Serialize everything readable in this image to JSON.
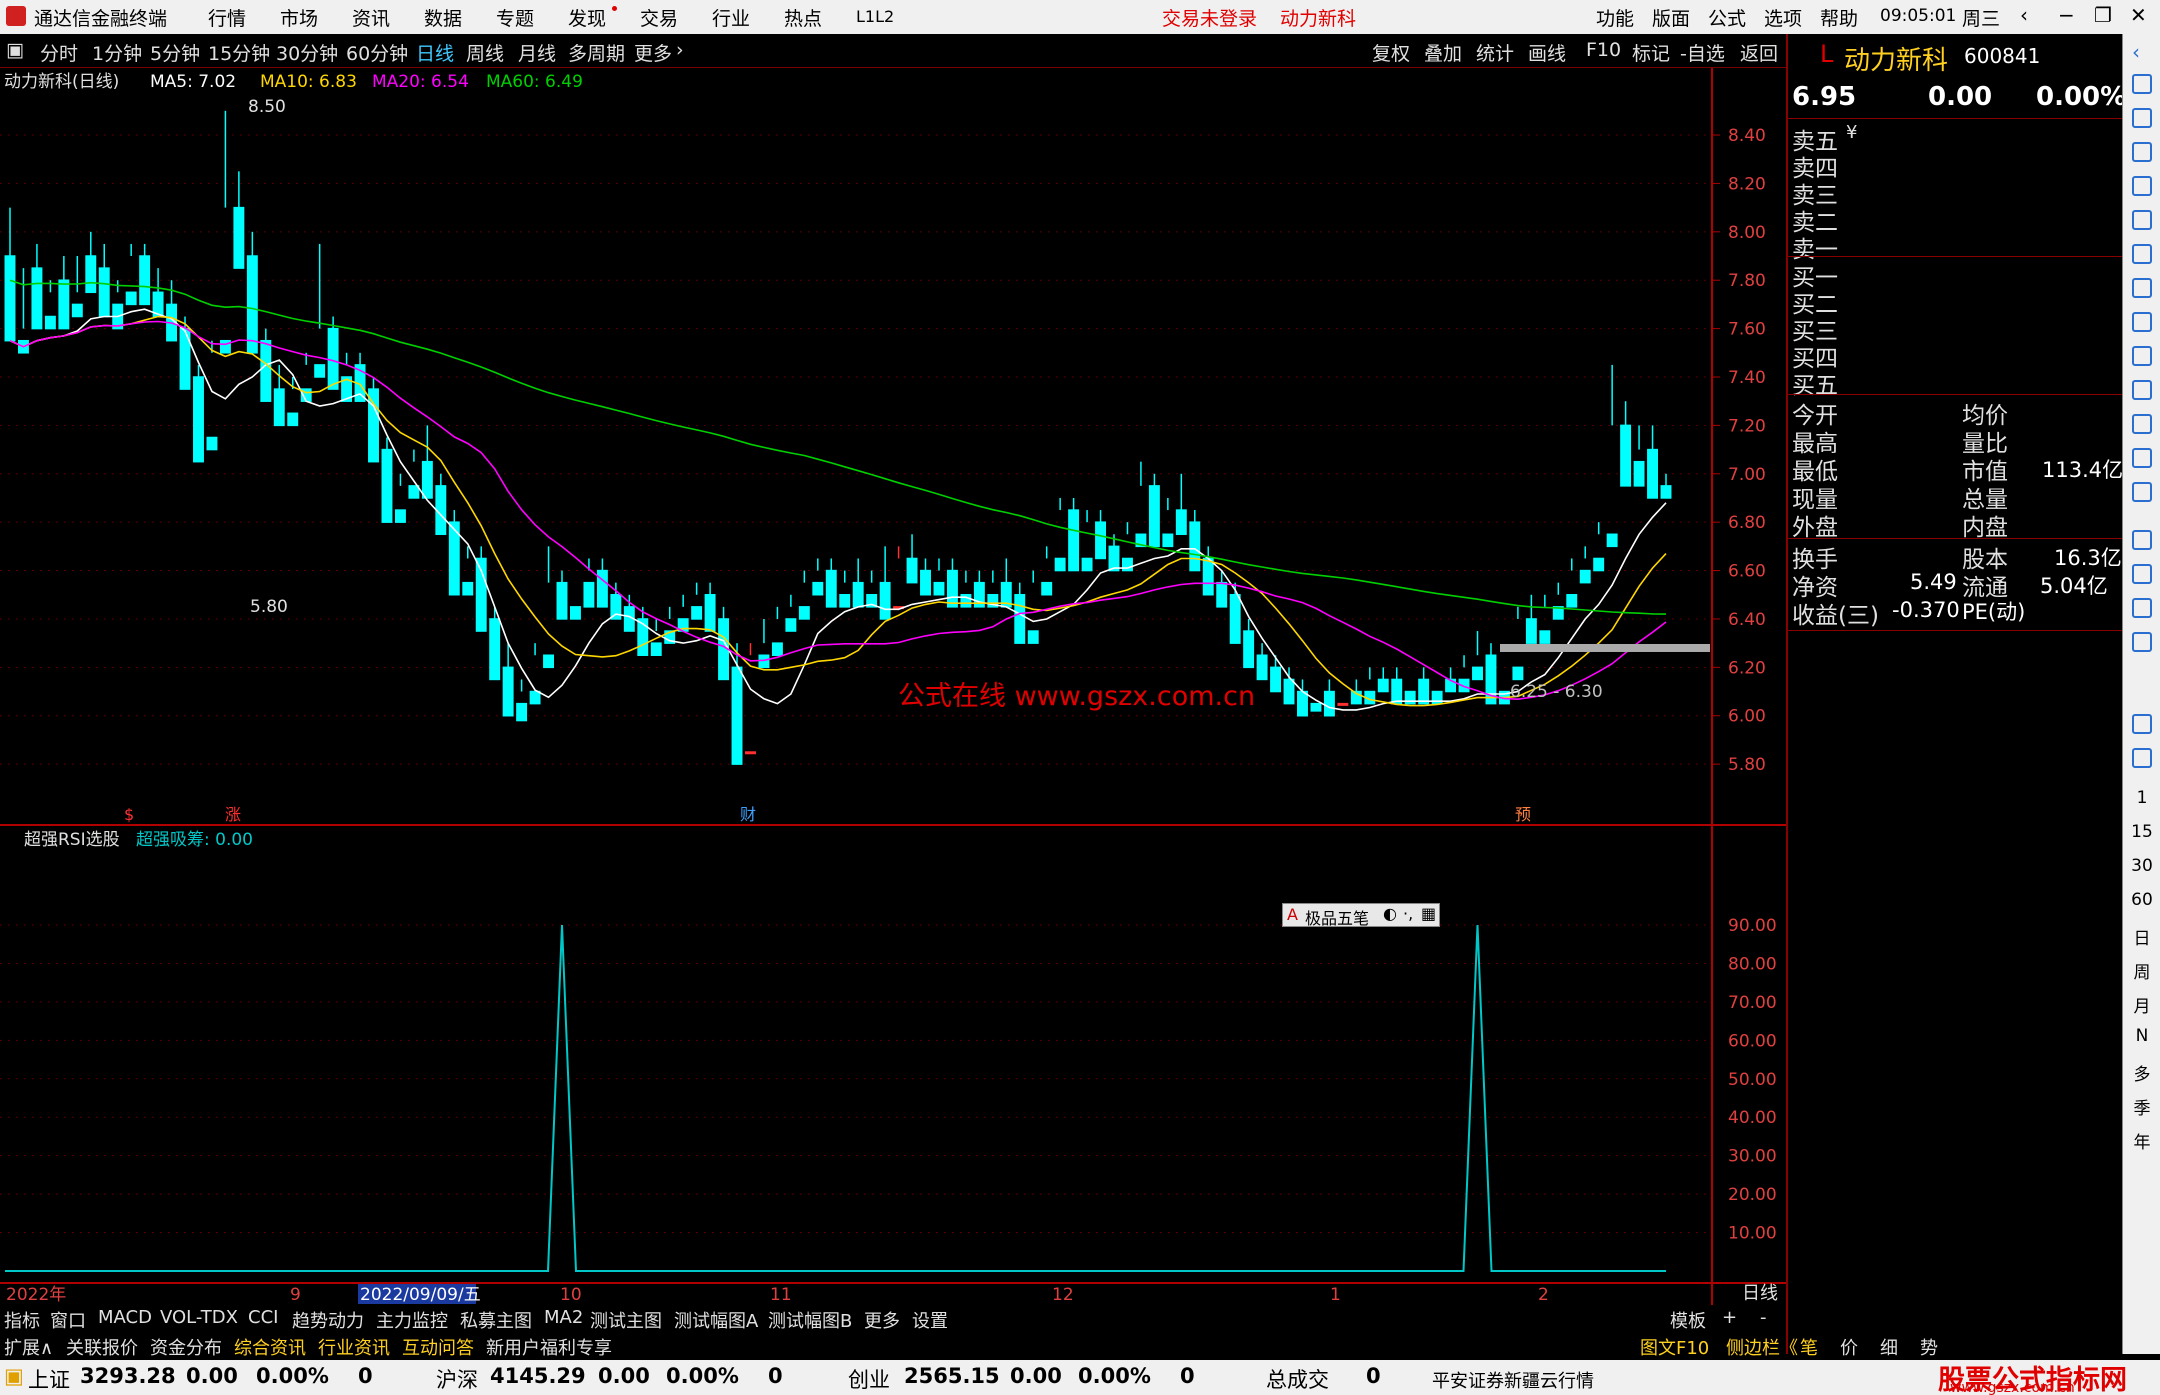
{
  "app": {
    "title": "通达信金融终端",
    "menus": [
      "行情",
      "市场",
      "资讯",
      "数据",
      "专题",
      "发现",
      "交易",
      "行业",
      "热点",
      "L1L2"
    ],
    "login": "交易未登录",
    "stock_link": "动力新科",
    "right_menus": [
      "功能",
      "版面",
      "公式",
      "选项",
      "帮助"
    ],
    "time": "09:05:01",
    "weekday": "周三"
  },
  "toolbar": {
    "periods": [
      "分时",
      "1分钟",
      "5分钟",
      "15分钟",
      "30分钟",
      "60分钟",
      "日线",
      "周线",
      "月线",
      "多周期",
      "更多"
    ],
    "selected": "日线",
    "tools": [
      "复权",
      "叠加",
      "统计",
      "画线",
      "F10",
      "标记",
      "-自选",
      "返回"
    ]
  },
  "main_chart": {
    "title": "动力新科(日线)",
    "ma5": "MA5: 7.02",
    "ma10": "MA10: 6.83",
    "ma20": "MA20: 6.54",
    "ma60": "MA60: 6.49",
    "high_label": "8.50",
    "low_label": "5.80",
    "range_label": "6.25 - 6.30",
    "watermark": "公式在线  www.gszx.com.cn",
    "markers": [
      "$",
      "涨",
      "财",
      "预"
    ]
  },
  "sub_chart": {
    "title": "超强RSI选股",
    "value_label": "超强吸筹: 0.00"
  },
  "popup": {
    "label": "极品五笔"
  },
  "colors": {
    "up": "#ff3030",
    "down": "#00ffff",
    "ma5": "#ffffff",
    "ma10": "#ffd700",
    "ma20": "#ff00ff",
    "ma60": "#00d000",
    "axis": "#b00000",
    "rsi": "#00c8c8"
  },
  "chart_data": [
    {
      "type": "candlestick",
      "title": "动力新科(日线)",
      "ylim": [
        5.7,
        8.5
      ],
      "yticks": [
        5.8,
        6.0,
        6.2,
        6.4,
        6.6,
        6.8,
        7.0,
        7.2,
        7.4,
        7.6,
        7.8,
        8.0,
        8.2,
        8.4
      ],
      "high_marker": 8.5,
      "low_marker": 5.8,
      "x_labels": [
        "2022年",
        "9",
        "2022/09/09/五",
        "10",
        "11",
        "12",
        "1",
        "2"
      ],
      "candles": [
        [
          7.9,
          8.1,
          7.6,
          7.55
        ],
        [
          7.55,
          7.6,
          7.85,
          7.5
        ],
        [
          7.85,
          7.95,
          7.65,
          7.6
        ],
        [
          7.65,
          7.75,
          7.8,
          7.6
        ],
        [
          7.8,
          7.9,
          7.7,
          7.6
        ],
        [
          7.7,
          7.75,
          7.9,
          7.65
        ],
        [
          7.9,
          8.0,
          7.85,
          7.75
        ],
        [
          7.85,
          7.95,
          7.7,
          7.65
        ],
        [
          7.7,
          7.8,
          7.75,
          7.6
        ],
        [
          7.75,
          7.95,
          7.9,
          7.7
        ],
        [
          7.9,
          7.95,
          7.75,
          7.7
        ],
        [
          7.75,
          7.85,
          7.7,
          7.65
        ],
        [
          7.7,
          7.8,
          7.6,
          7.55
        ],
        [
          7.6,
          7.65,
          7.4,
          7.35
        ],
        [
          7.4,
          7.45,
          7.15,
          7.05
        ],
        [
          7.15,
          7.5,
          7.55,
          7.1
        ],
        [
          7.55,
          8.5,
          8.1,
          7.5
        ],
        [
          8.1,
          8.25,
          7.9,
          7.85
        ],
        [
          7.9,
          8.0,
          7.55,
          7.5
        ],
        [
          7.55,
          7.6,
          7.35,
          7.3
        ],
        [
          7.35,
          7.45,
          7.25,
          7.2
        ],
        [
          7.25,
          7.4,
          7.35,
          7.2
        ],
        [
          7.35,
          7.5,
          7.45,
          7.3
        ],
        [
          7.45,
          7.95,
          7.6,
          7.4
        ],
        [
          7.6,
          7.65,
          7.4,
          7.35
        ],
        [
          7.4,
          7.5,
          7.45,
          7.3
        ],
        [
          7.45,
          7.5,
          7.35,
          7.3
        ],
        [
          7.35,
          7.4,
          7.1,
          7.05
        ],
        [
          7.1,
          7.15,
          6.85,
          6.8
        ],
        [
          6.85,
          7.0,
          6.95,
          6.8
        ],
        [
          6.95,
          7.1,
          7.05,
          6.9
        ],
        [
          7.05,
          7.2,
          6.95,
          6.9
        ],
        [
          6.95,
          7.0,
          6.8,
          6.75
        ],
        [
          6.8,
          6.85,
          6.55,
          6.5
        ],
        [
          6.55,
          6.7,
          6.65,
          6.5
        ],
        [
          6.65,
          6.7,
          6.4,
          6.35
        ],
        [
          6.4,
          6.45,
          6.2,
          6.15
        ],
        [
          6.2,
          6.3,
          6.05,
          6.0
        ],
        [
          6.05,
          6.15,
          6.1,
          5.98
        ],
        [
          6.1,
          6.3,
          6.25,
          6.05
        ],
        [
          6.25,
          6.7,
          6.55,
          6.2
        ],
        [
          6.55,
          6.6,
          6.45,
          6.4
        ],
        [
          6.45,
          6.55,
          6.55,
          6.4
        ],
        [
          6.55,
          6.65,
          6.6,
          6.45
        ],
        [
          6.6,
          6.65,
          6.5,
          6.45
        ],
        [
          6.5,
          6.55,
          6.45,
          6.4
        ],
        [
          6.45,
          6.5,
          6.4,
          6.35
        ],
        [
          6.4,
          6.45,
          6.3,
          6.25
        ],
        [
          6.3,
          6.4,
          6.35,
          6.25
        ],
        [
          6.35,
          6.45,
          6.4,
          6.3
        ],
        [
          6.4,
          6.5,
          6.45,
          6.35
        ],
        [
          6.45,
          6.55,
          6.5,
          6.4
        ],
        [
          6.5,
          6.55,
          6.4,
          6.35
        ],
        [
          6.4,
          6.45,
          6.2,
          6.15
        ],
        [
          6.2,
          6.3,
          5.85,
          5.8
        ],
        [
          5.85,
          6.3,
          6.25,
          5.85
        ],
        [
          6.25,
          6.4,
          6.3,
          6.2
        ],
        [
          6.3,
          6.45,
          6.4,
          6.25
        ],
        [
          6.4,
          6.5,
          6.45,
          6.35
        ],
        [
          6.45,
          6.6,
          6.55,
          6.4
        ],
        [
          6.55,
          6.65,
          6.6,
          6.5
        ],
        [
          6.6,
          6.65,
          6.5,
          6.45
        ],
        [
          6.5,
          6.6,
          6.55,
          6.45
        ],
        [
          6.55,
          6.65,
          6.5,
          6.45
        ],
        [
          6.5,
          6.6,
          6.55,
          6.45
        ],
        [
          6.55,
          6.7,
          6.45,
          6.4
        ],
        [
          6.45,
          6.7,
          6.65,
          6.45
        ],
        [
          6.65,
          6.75,
          6.6,
          6.55
        ],
        [
          6.6,
          6.65,
          6.55,
          6.5
        ],
        [
          6.55,
          6.65,
          6.6,
          6.5
        ],
        [
          6.6,
          6.65,
          6.5,
          6.45
        ],
        [
          6.5,
          6.6,
          6.55,
          6.45
        ],
        [
          6.55,
          6.6,
          6.5,
          6.45
        ],
        [
          6.5,
          6.6,
          6.55,
          6.45
        ],
        [
          6.55,
          6.65,
          6.5,
          6.45
        ],
        [
          6.5,
          6.55,
          6.35,
          6.3
        ],
        [
          6.35,
          6.6,
          6.55,
          6.3
        ],
        [
          6.55,
          6.7,
          6.65,
          6.5
        ],
        [
          6.65,
          6.9,
          6.85,
          6.6
        ],
        [
          6.85,
          6.9,
          6.65,
          6.6
        ],
        [
          6.65,
          6.85,
          6.8,
          6.6
        ],
        [
          6.8,
          6.85,
          6.7,
          6.65
        ],
        [
          6.7,
          6.75,
          6.65,
          6.6
        ],
        [
          6.65,
          6.8,
          6.75,
          6.6
        ],
        [
          6.75,
          7.05,
          6.95,
          6.7
        ],
        [
          6.95,
          7.0,
          6.75,
          6.7
        ],
        [
          6.75,
          6.9,
          6.85,
          6.7
        ],
        [
          6.85,
          7.0,
          6.8,
          6.75
        ],
        [
          6.8,
          6.85,
          6.65,
          6.6
        ],
        [
          6.65,
          6.7,
          6.55,
          6.5
        ],
        [
          6.55,
          6.6,
          6.5,
          6.45
        ],
        [
          6.5,
          6.55,
          6.35,
          6.3
        ],
        [
          6.35,
          6.4,
          6.25,
          6.2
        ],
        [
          6.25,
          6.3,
          6.2,
          6.15
        ],
        [
          6.2,
          6.25,
          6.15,
          6.1
        ],
        [
          6.15,
          6.2,
          6.1,
          6.05
        ],
        [
          6.1,
          6.15,
          6.05,
          6.0
        ],
        [
          6.05,
          6.1,
          6.1,
          6.02
        ],
        [
          6.1,
          6.15,
          6.05,
          6.0
        ],
        [
          6.05,
          6.1,
          6.1,
          6.05
        ],
        [
          6.1,
          6.15,
          6.1,
          6.05
        ],
        [
          6.1,
          6.2,
          6.15,
          6.05
        ],
        [
          6.15,
          6.2,
          6.15,
          6.1
        ],
        [
          6.15,
          6.2,
          6.1,
          6.05
        ],
        [
          6.1,
          6.15,
          6.15,
          6.05
        ],
        [
          6.15,
          6.2,
          6.1,
          6.05
        ],
        [
          6.1,
          6.15,
          6.15,
          6.05
        ],
        [
          6.15,
          6.2,
          6.15,
          6.1
        ],
        [
          6.15,
          6.25,
          6.2,
          6.1
        ],
        [
          6.2,
          6.35,
          6.25,
          6.15
        ],
        [
          6.25,
          6.3,
          6.1,
          6.05
        ],
        [
          6.1,
          6.2,
          6.2,
          6.05
        ],
        [
          6.2,
          6.45,
          6.4,
          6.15
        ],
        [
          6.4,
          6.5,
          6.35,
          6.3
        ],
        [
          6.35,
          6.5,
          6.45,
          6.3
        ],
        [
          6.45,
          6.55,
          6.5,
          6.4
        ],
        [
          6.5,
          6.65,
          6.6,
          6.45
        ],
        [
          6.6,
          6.7,
          6.65,
          6.55
        ],
        [
          6.65,
          6.8,
          6.75,
          6.6
        ],
        [
          6.75,
          7.45,
          7.2,
          6.7
        ],
        [
          7.2,
          7.3,
          7.05,
          6.95
        ],
        [
          7.05,
          7.2,
          7.1,
          6.95
        ],
        [
          7.1,
          7.2,
          6.95,
          6.9
        ],
        [
          6.95,
          7.0,
          6.95,
          6.9
        ]
      ],
      "series": [
        {
          "name": "MA5",
          "value": 7.02
        },
        {
          "name": "MA10",
          "value": 6.83
        },
        {
          "name": "MA20",
          "value": 6.54
        },
        {
          "name": "MA60",
          "value": 6.49
        }
      ]
    },
    {
      "type": "line",
      "title": "超强RSI选股",
      "ylim": [
        0,
        100
      ],
      "yticks": [
        10,
        20,
        30,
        40,
        50,
        60,
        70,
        80,
        90
      ],
      "series": [
        {
          "name": "超强吸筹",
          "value": 0,
          "spikes": [
            {
              "bar": 41,
              "value": 90
            },
            {
              "bar": 109,
              "value": 90
            }
          ]
        }
      ]
    }
  ],
  "quote": {
    "name": "动力新科",
    "code": "600841",
    "price": "6.95",
    "change": "0.00",
    "pct": "0.00%",
    "sells": [
      "卖五",
      "卖四",
      "卖三",
      "卖二",
      "卖一"
    ],
    "buys": [
      "买一",
      "买二",
      "买三",
      "买四",
      "买五"
    ],
    "currency": "¥",
    "stats_left": [
      "今开",
      "最高",
      "最低",
      "现量",
      "外盘"
    ],
    "stats_right": [
      "均价",
      "量比",
      "市值",
      "总量",
      "内盘"
    ],
    "mktcap": "113.4亿",
    "fin_left": [
      "换手",
      "净资",
      "收益(三)"
    ],
    "fin_mid": [
      "股本",
      "流通",
      "PE(动)"
    ],
    "net_asset": "5.49",
    "eps": "-0.370",
    "shares": "16.3亿",
    "float": "5.04亿"
  },
  "side": {
    "labels": [
      "1",
      "15",
      "30",
      "60",
      "日",
      "周",
      "月",
      "N",
      "多",
      "季",
      "年"
    ]
  },
  "bottom_tabs1": [
    "指标",
    "窗口",
    "MACD",
    "VOL-TDX",
    "CCI",
    "趋势动力",
    "主力监控",
    "私募主图",
    "MA2",
    "测试主图",
    "测试幅图A",
    "测试幅图B",
    "更多",
    "设置"
  ],
  "bottom_tabs1_right": [
    "模板",
    "+",
    "-"
  ],
  "bottom_tabs2": [
    "扩展∧",
    "关联报价",
    "资金分布",
    "综合资讯",
    "行业资讯",
    "互动问答",
    "新用户福利专享"
  ],
  "bottom_tabs2_right": [
    "图文F10",
    "侧边栏《",
    "笔",
    "价",
    "细",
    "势"
  ],
  "day_label": "日线",
  "status": {
    "sh": [
      "上证",
      "3293.28",
      "0.00",
      "0.00%",
      "0"
    ],
    "hs": [
      "沪深",
      "4145.29",
      "0.00",
      "0.00%",
      "0"
    ],
    "cy": [
      "创业",
      "2565.15",
      "0.00",
      "0.00%",
      "0"
    ],
    "vol": [
      "总成交",
      "0"
    ],
    "broker": "平安证券新疆云行情",
    "brand": "股票公式指标网",
    "brand_url": "www.gszx.com.cn"
  }
}
